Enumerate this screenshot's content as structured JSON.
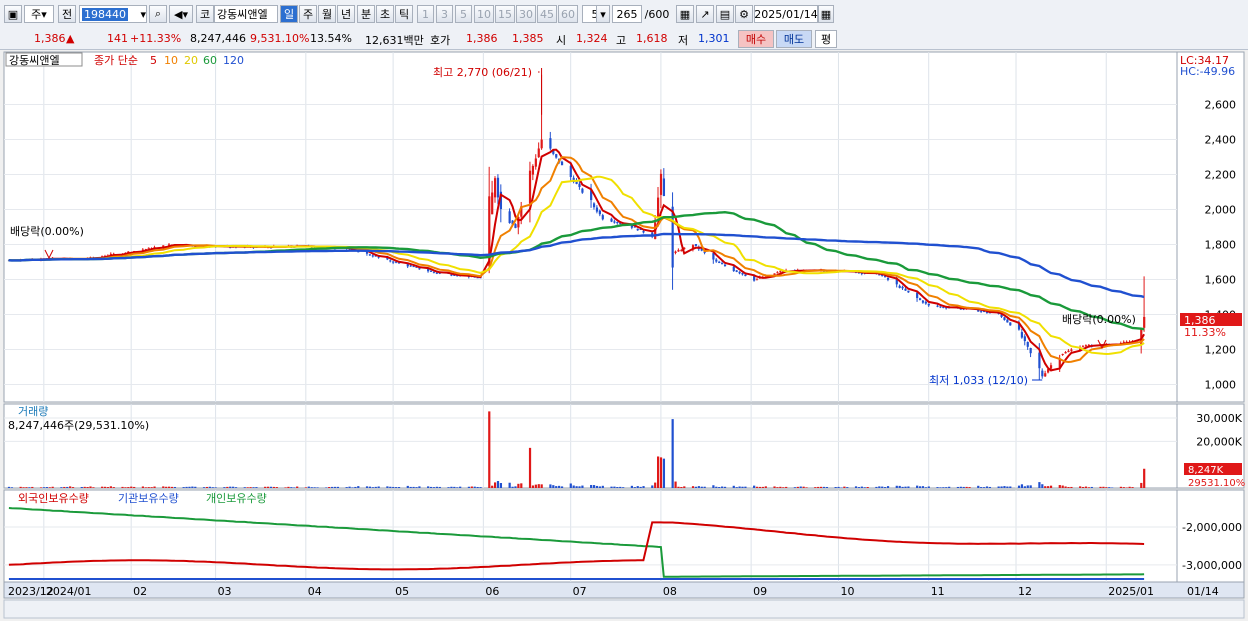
{
  "toolbar": {
    "period_prefix": "주",
    "prev_label": "전",
    "code": "198440",
    "market_label": "코",
    "name": "강동씨앤엘",
    "period_tabs": [
      "일",
      "주",
      "월",
      "년",
      "분",
      "초",
      "틱"
    ],
    "active_period": "일",
    "intervals": [
      "1",
      "3",
      "5",
      "10",
      "15",
      "30",
      "45",
      "60"
    ],
    "interval_value": "5",
    "count": "265",
    "count_max": "/600",
    "date": "2025/01/14"
  },
  "quote": {
    "price": "1,386",
    "arrow": "▲",
    "change": "141",
    "change_pct": "+11.33%",
    "volume": "8,247,446",
    "volume_pct": "9,531.10%",
    "turnover": "13.54%",
    "amount": "12,631백만",
    "hoga_label": "호가",
    "hoga_ask": "1,386",
    "hoga_bid": "1,385",
    "open_label": "시",
    "open": "1,324",
    "high_label": "고",
    "high": "1,618",
    "low_label": "저",
    "low": "1,301",
    "buy_label": "매수",
    "sell_label": "매도",
    "eval_label": "평"
  },
  "price_panel": {
    "name": "강동씨앤엘",
    "legend_prefix": "종가 단순",
    "ma_periods": [
      "5",
      "10",
      "20",
      "60",
      "120"
    ],
    "ma_colors": [
      "#d00000",
      "#f08000",
      "#f0e000",
      "#1a9a3a",
      "#2050d0"
    ],
    "lc": "LC:34.17",
    "hc": "HC:-49.96",
    "high_annot": "최고 2,770 (06/21)",
    "low_annot": "최저 1,033 (12/10)",
    "dividend_annot": "배당락(0.00%)",
    "current_price_tag": "1,386",
    "current_pct_tag": "11.33%"
  },
  "volume_panel": {
    "title": "거래량",
    "summary": "8,247,446주(29,531.10%)",
    "tag1": "8,247K",
    "tag2": "29531.10%"
  },
  "holding_panel": {
    "series_titles": [
      "외국인보유수량",
      "기관보유수량",
      "개인보유수량"
    ],
    "series_colors": [
      "#d00000",
      "#2050d0",
      "#1a9a3a"
    ]
  },
  "x_axis": {
    "labels": [
      "2023/12",
      "2024/01",
      "02",
      "03",
      "04",
      "05",
      "06",
      "07",
      "08",
      "09",
      "10",
      "11",
      "12",
      "2025/01"
    ],
    "right_label": "01/14"
  },
  "chart_data": {
    "type": "candlestick",
    "price_axis": {
      "ticks": [
        1000,
        1200,
        1400,
        1600,
        1800,
        2000,
        2200,
        2400,
        2600
      ],
      "range": [
        900,
        2900
      ]
    },
    "volume_axis": {
      "ticks": [
        20000,
        30000
      ],
      "unit": "K"
    },
    "holding_axis": {
      "ticks": [
        -2000000,
        -3000000
      ]
    },
    "close_series": [
      [
        "2023-12-21",
        1710
      ],
      [
        "2024-01-02",
        1720
      ],
      [
        "2024-01-15",
        1715
      ],
      [
        "2024-02-01",
        1760
      ],
      [
        "2024-02-15",
        1800
      ],
      [
        "2024-03-01",
        1790
      ],
      [
        "2024-03-15",
        1785
      ],
      [
        "2024-04-01",
        1790
      ],
      [
        "2024-04-15",
        1780
      ],
      [
        "2024-05-01",
        1700
      ],
      [
        "2024-05-15",
        1640
      ],
      [
        "2024-05-31",
        1610
      ],
      [
        "2024-06-05",
        2200
      ],
      [
        "2024-06-07",
        2000
      ],
      [
        "2024-06-12",
        1900
      ],
      [
        "2024-06-17",
        2200
      ],
      [
        "2024-06-21",
        2400
      ],
      [
        "2024-06-28",
        2250
      ],
      [
        "2024-07-05",
        2100
      ],
      [
        "2024-07-12",
        1950
      ],
      [
        "2024-07-22",
        1900
      ],
      [
        "2024-07-29",
        1850
      ],
      [
        "2024-08-01",
        2170
      ],
      [
        "2024-08-05",
        1750
      ],
      [
        "2024-08-12",
        1800
      ],
      [
        "2024-08-20",
        1700
      ],
      [
        "2024-09-02",
        1600
      ],
      [
        "2024-09-12",
        1650
      ],
      [
        "2024-10-01",
        1650
      ],
      [
        "2024-10-15",
        1630
      ],
      [
        "2024-11-01",
        1450
      ],
      [
        "2024-11-15",
        1430
      ],
      [
        "2024-11-25",
        1400
      ],
      [
        "2024-12-02",
        1300
      ],
      [
        "2024-12-10",
        1050
      ],
      [
        "2024-12-16",
        1170
      ],
      [
        "2024-12-23",
        1220
      ],
      [
        "2025-01-02",
        1230
      ],
      [
        "2025-01-10",
        1245
      ],
      [
        "2025-01-14",
        1386
      ]
    ],
    "annotations": {
      "high": {
        "date": "2024-06-21",
        "value": 2770
      },
      "low": {
        "date": "2024-12-10",
        "value": 1033
      }
    }
  }
}
